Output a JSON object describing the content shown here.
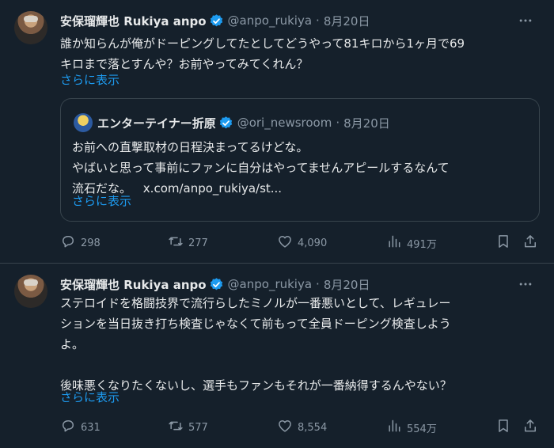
{
  "tweets": [
    {
      "author": "安保瑠輝也 Rukiya anpo",
      "handle": "@anpo_rukiya",
      "date": "8月20日",
      "text_lines": [
        "誰か知らんが俺がドーピングしてたとしてどうやって81キロから1ヶ月で69",
        "キロまで落とすんや？お前やってみてくれん？"
      ],
      "show_more": "さらに表示",
      "quote": {
        "author": "エンターテイナー折原",
        "handle": "@ori_newsroom",
        "date": "8月20日",
        "text_lines": [
          "お前への直撃取材の日程決まってるけどな。",
          "やばいと思って事前にファンに自分はやってませんアピールするなんて"
        ],
        "line3_text": "流石だな。",
        "line3_link": "x.com/anpo_rukiya/st...",
        "show_more": "さらに表示"
      },
      "stats": {
        "replies": "298",
        "retweets": "277",
        "likes": "4,090",
        "views": "491万"
      }
    },
    {
      "author": "安保瑠輝也 Rukiya anpo",
      "handle": "@anpo_rukiya",
      "date": "8月20日",
      "text_lines": [
        "ステロイドを格闘技界で流行らしたミノルが一番悪いとして、レギュレー",
        "ションを当日抜き打ち検査じゃなくて前もって全員ドーピング検査しよう",
        "よ。",
        "",
        "後味悪くなりたくないし、選手もファンもそれが一番納得するんやない？"
      ],
      "show_more": "さらに表示",
      "stats": {
        "replies": "631",
        "retweets": "577",
        "likes": "8,554",
        "views": "554万"
      }
    }
  ],
  "icons": {
    "verified": "verified-badge-icon",
    "more": "more-icon",
    "reply": "reply-icon",
    "retweet": "retweet-icon",
    "like": "heart-icon",
    "views": "views-icon",
    "bookmark": "bookmark-icon",
    "share": "share-icon"
  },
  "colors": {
    "background": "#15202b",
    "text": "#e7e9ea",
    "muted": "#8b98a5",
    "accent": "#1d9bf0",
    "border": "#38444d"
  }
}
